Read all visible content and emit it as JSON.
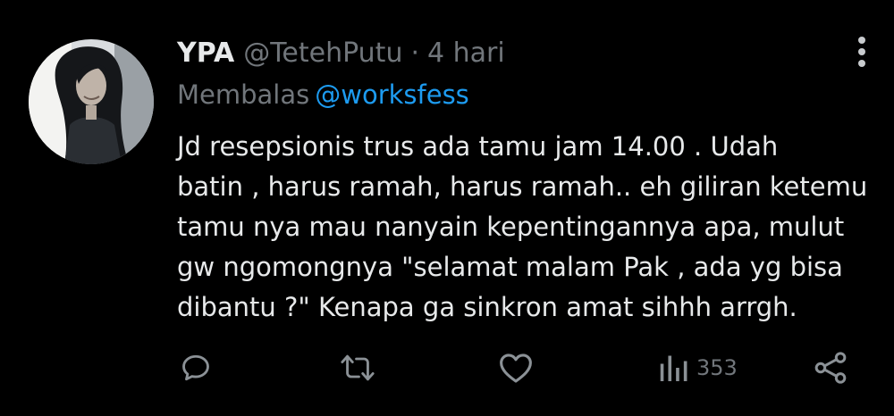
{
  "tweet": {
    "display_name": "YPA",
    "handle": "@TetehPutu",
    "separator": "·",
    "time": "4 hari",
    "reply_prefix": "Membalas",
    "reply_to": "@worksfess",
    "text": "Jd resepsionis trus ada tamu jam 14.00 . Udah\nbatin , harus ramah, harus ramah.. eh giliran ketemu\ntamu nya mau nanyain kepentingannya apa, mulut\ngw ngomongnya \"selamat malam Pak , ada yg bisa\ndibantu ?\" Kenapa ga sinkron amat sihhh arrgh."
  },
  "actions": {
    "views_count": "353"
  },
  "icons": {
    "more": "more-vertical-icon",
    "reply": "reply-bubble-icon",
    "retweet": "retweet-icon",
    "like": "heart-icon",
    "views": "views-bar-chart-icon",
    "share": "share-icon"
  },
  "colors": {
    "background": "#000000",
    "text_primary": "#e7e9ea",
    "text_muted": "#71767b",
    "link": "#1d9bf0"
  }
}
